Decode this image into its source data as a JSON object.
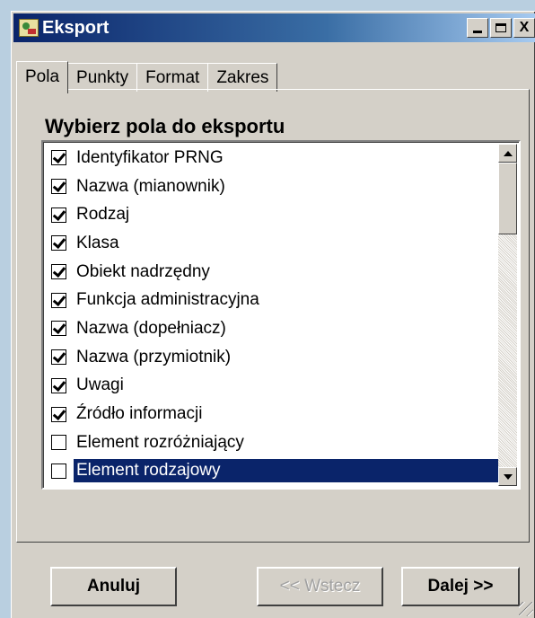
{
  "window": {
    "title": "Eksport",
    "controls": {
      "minimize": "_",
      "maximize": "□",
      "close": "X"
    }
  },
  "tabs": [
    {
      "label": "Pola",
      "active": true
    },
    {
      "label": "Punkty",
      "active": false
    },
    {
      "label": "Format",
      "active": false
    },
    {
      "label": "Zakres",
      "active": false
    }
  ],
  "fields": {
    "heading": "Wybierz pola do eksportu",
    "items": [
      {
        "label": "Identyfikator PRNG",
        "checked": true
      },
      {
        "label": "Nazwa (mianownik)",
        "checked": true
      },
      {
        "label": "Rodzaj",
        "checked": true
      },
      {
        "label": "Klasa",
        "checked": true
      },
      {
        "label": "Obiekt nadrzędny",
        "checked": true
      },
      {
        "label": "Funkcja administracyjna",
        "checked": true
      },
      {
        "label": "Nazwa (dopełniacz)",
        "checked": true
      },
      {
        "label": "Nazwa (przymiotnik)",
        "checked": true
      },
      {
        "label": "Uwagi",
        "checked": true
      },
      {
        "label": "Źródło informacji",
        "checked": true
      },
      {
        "label": "Element rozróżniający",
        "checked": false
      },
      {
        "label": "Element rodzajowy",
        "checked": false,
        "selected": true
      }
    ]
  },
  "buttons": {
    "cancel": "Anuluj",
    "back": "<< Wstecz",
    "next": "Dalej >>"
  },
  "colors": {
    "selection": "#0a246a",
    "face": "#d4d0c8"
  }
}
